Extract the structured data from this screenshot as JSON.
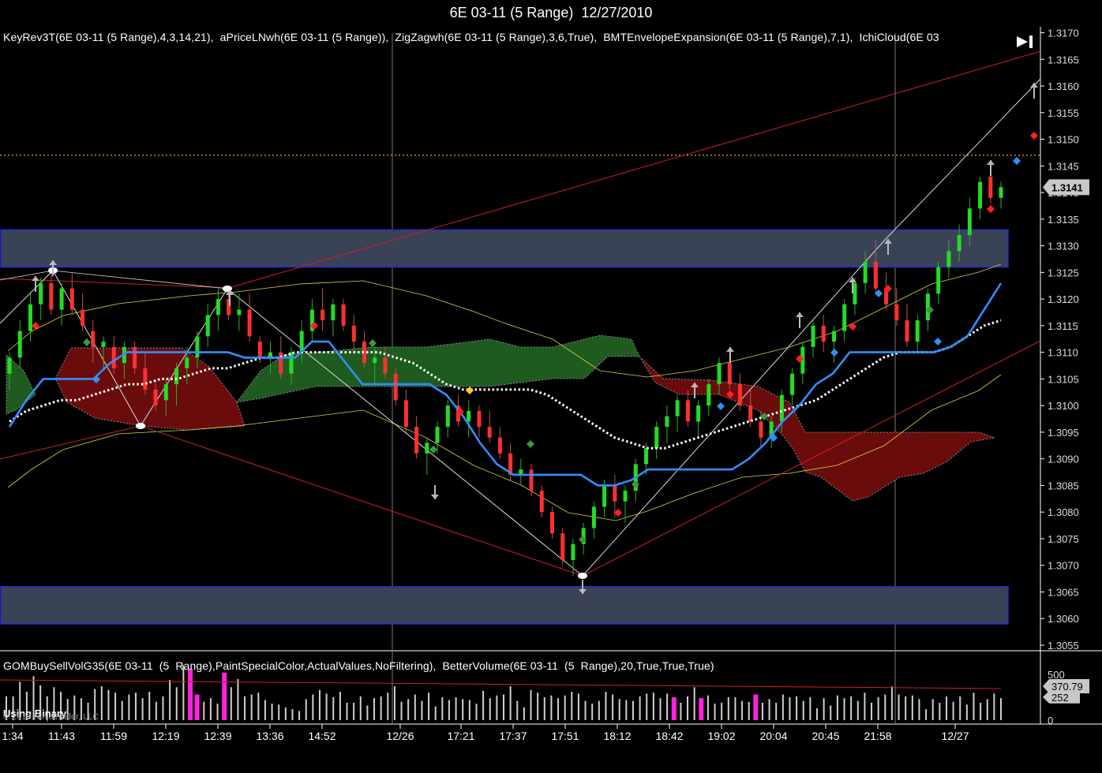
{
  "window": {
    "title": "6E 03-11 (5 Range)  12/27/2010"
  },
  "indicators_top": "KeyRev3T(6E 03-11 (5 Range),4,3,14,21),  aPriceLNwh(6E 03-11 (5 Range)),  ZigZagwh(6E 03-11 (5 Range),3,6,True),  BMTEnvelopeExpansion(6E 03-11 (5 Range),7,1),  IchiCloud(6E 03",
  "indicators_bottom": "GOMBuySellVolG35(6E 03-11  (5  Range),PaintSpecialColor,ActualValues,NoFiltering),  BetterVolume(6E 03-11  (5  Range),20,True,True,True)",
  "copyright": "© 2010 NinjaTrader, LLC",
  "using_binary": "Using Binary",
  "icons": {
    "play": "skip-forward-icon"
  },
  "colors": {
    "bull": "#22dd22",
    "bear": "#ff3030",
    "cloud_bull": "#1f5a1f",
    "cloud_bear": "#6b0c0c",
    "zone": "#3a4356",
    "kijun": "#2f8fff",
    "tenkan": "#ffffff",
    "volume_hi": "#ff22dd"
  },
  "chart_data": {
    "type": "candlestick",
    "price_axis": {
      "ylim": [
        1.3052,
        1.3172
      ],
      "ticks": [
        "1.3170",
        "1.3165",
        "1.3160",
        "1.3155",
        "1.3150",
        "1.3145",
        "1.3140",
        "1.3135",
        "1.3130",
        "1.3125",
        "1.3120",
        "1.3115",
        "1.3110",
        "1.3105",
        "1.3100",
        "1.3095",
        "1.3090",
        "1.3085",
        "1.3080",
        "1.3075",
        "1.3070",
        "1.3065",
        "1.3060",
        "1.3055"
      ],
      "last_price": "1.3141",
      "horizontal_line": 1.3147
    },
    "time_axis": {
      "labels": [
        "1:34",
        "11:43",
        "11:59",
        "12:19",
        "12:39",
        "13:36",
        "14:52",
        "12/26",
        "17:21",
        "17:37",
        "17:51",
        "18:12",
        "18:42",
        "19:02",
        "20:04",
        "20:45",
        "21:58",
        "12/27"
      ]
    },
    "zones": [
      {
        "top": 1.3133,
        "bottom": 1.3126
      },
      {
        "top": 1.3066,
        "bottom": 1.3059
      }
    ],
    "candles": [
      [
        1.3106,
        1.311,
        1.3103,
        1.3109
      ],
      [
        1.3109,
        1.3116,
        1.3107,
        1.3114
      ],
      [
        1.3114,
        1.3121,
        1.3112,
        1.3119
      ],
      [
        1.3119,
        1.3124,
        1.3116,
        1.3123
      ],
      [
        1.3123,
        1.3125,
        1.3117,
        1.3118
      ],
      [
        1.3118,
        1.3123,
        1.3115,
        1.3122
      ],
      [
        1.3122,
        1.3125,
        1.3117,
        1.3118
      ],
      [
        1.3118,
        1.3121,
        1.3114,
        1.3115
      ],
      [
        1.3114,
        1.3116,
        1.3108,
        1.3111
      ],
      [
        1.3111,
        1.3113,
        1.3107,
        1.3112
      ],
      [
        1.3111,
        1.3113,
        1.3106,
        1.3107
      ],
      [
        1.3108,
        1.3112,
        1.3105,
        1.3111
      ],
      [
        1.3111,
        1.3112,
        1.3106,
        1.3107
      ],
      [
        1.3107,
        1.311,
        1.3102,
        1.3103
      ],
      [
        1.3103,
        1.3105,
        1.3099,
        1.31
      ],
      [
        1.3101,
        1.3105,
        1.3098,
        1.3104
      ],
      [
        1.3104,
        1.3108,
        1.31,
        1.3107
      ],
      [
        1.3107,
        1.3111,
        1.3104,
        1.3109
      ],
      [
        1.3109,
        1.3114,
        1.3107,
        1.3113
      ],
      [
        1.3113,
        1.3119,
        1.3111,
        1.3117
      ],
      [
        1.3117,
        1.3122,
        1.3114,
        1.312
      ],
      [
        1.312,
        1.3122,
        1.3116,
        1.3117
      ],
      [
        1.3117,
        1.3121,
        1.3114,
        1.3118
      ],
      [
        1.3118,
        1.3121,
        1.3112,
        1.3113
      ],
      [
        1.3112,
        1.3113,
        1.3108,
        1.3109
      ],
      [
        1.3109,
        1.3112,
        1.3106,
        1.311
      ],
      [
        1.311,
        1.3113,
        1.3105,
        1.3106
      ],
      [
        1.3106,
        1.3111,
        1.3104,
        1.311
      ],
      [
        1.311,
        1.3116,
        1.3108,
        1.3114
      ],
      [
        1.3114,
        1.312,
        1.3112,
        1.3118
      ],
      [
        1.3118,
        1.3122,
        1.3114,
        1.3116
      ],
      [
        1.3116,
        1.312,
        1.3113,
        1.3119
      ],
      [
        1.3119,
        1.312,
        1.3114,
        1.3115
      ],
      [
        1.3115,
        1.3117,
        1.311,
        1.3112
      ],
      [
        1.3112,
        1.3114,
        1.3107,
        1.3108
      ],
      [
        1.3108,
        1.3111,
        1.3104,
        1.3109
      ],
      [
        1.3109,
        1.3111,
        1.3105,
        1.3106
      ],
      [
        1.3106,
        1.3107,
        1.31,
        1.3101
      ],
      [
        1.3101,
        1.3103,
        1.3095,
        1.3096
      ],
      [
        1.3096,
        1.3098,
        1.309,
        1.3091
      ],
      [
        1.3091,
        1.3094,
        1.3087,
        1.3093
      ],
      [
        1.3093,
        1.3097,
        1.3091,
        1.3096
      ],
      [
        1.3096,
        1.3101,
        1.3094,
        1.31
      ],
      [
        1.31,
        1.3102,
        1.3096,
        1.3097
      ],
      [
        1.3097,
        1.3101,
        1.3094,
        1.3099
      ],
      [
        1.3099,
        1.31,
        1.3094,
        1.3096
      ],
      [
        1.3096,
        1.3099,
        1.3093,
        1.3094
      ],
      [
        1.3094,
        1.3096,
        1.309,
        1.3091
      ],
      [
        1.3091,
        1.3093,
        1.3086,
        1.3087
      ],
      [
        1.3087,
        1.309,
        1.3085,
        1.3088
      ],
      [
        1.3088,
        1.3089,
        1.3083,
        1.3084
      ],
      [
        1.3084,
        1.3085,
        1.3079,
        1.308
      ],
      [
        1.308,
        1.3081,
        1.3075,
        1.3076
      ],
      [
        1.3076,
        1.3077,
        1.307,
        1.3071
      ],
      [
        1.3071,
        1.3075,
        1.3068,
        1.3074
      ],
      [
        1.3074,
        1.3078,
        1.3072,
        1.3077
      ],
      [
        1.3077,
        1.3082,
        1.3075,
        1.3081
      ],
      [
        1.3081,
        1.3086,
        1.3079,
        1.3085
      ],
      [
        1.3085,
        1.3087,
        1.3079,
        1.3082
      ],
      [
        1.3082,
        1.3085,
        1.3078,
        1.3084
      ],
      [
        1.3084,
        1.309,
        1.3082,
        1.3089
      ],
      [
        1.3089,
        1.3093,
        1.3087,
        1.3092
      ],
      [
        1.3092,
        1.3097,
        1.309,
        1.3096
      ],
      [
        1.3096,
        1.31,
        1.3093,
        1.3098
      ],
      [
        1.3098,
        1.3102,
        1.3095,
        1.3101
      ],
      [
        1.3101,
        1.3103,
        1.3096,
        1.3097
      ],
      [
        1.3097,
        1.3101,
        1.3094,
        1.31
      ],
      [
        1.31,
        1.3105,
        1.3098,
        1.3104
      ],
      [
        1.3104,
        1.3109,
        1.3102,
        1.3108
      ],
      [
        1.3108,
        1.3111,
        1.3103,
        1.3104
      ],
      [
        1.3104,
        1.3106,
        1.3099,
        1.31
      ],
      [
        1.31,
        1.3103,
        1.3096,
        1.3097
      ],
      [
        1.3097,
        1.3099,
        1.3092,
        1.3094
      ],
      [
        1.3094,
        1.3098,
        1.3092,
        1.3097
      ],
      [
        1.3097,
        1.3103,
        1.3095,
        1.3102
      ],
      [
        1.3102,
        1.3107,
        1.31,
        1.3106
      ],
      [
        1.3106,
        1.3112,
        1.3104,
        1.3111
      ],
      [
        1.3111,
        1.3116,
        1.3109,
        1.3115
      ],
      [
        1.3115,
        1.3117,
        1.311,
        1.3112
      ],
      [
        1.3112,
        1.3115,
        1.3108,
        1.3114
      ],
      [
        1.3114,
        1.312,
        1.3112,
        1.3119
      ],
      [
        1.3119,
        1.3124,
        1.3117,
        1.3123
      ],
      [
        1.3123,
        1.3129,
        1.3121,
        1.3127
      ],
      [
        1.3127,
        1.3131,
        1.3121,
        1.3122
      ],
      [
        1.3122,
        1.3125,
        1.3118,
        1.3119
      ],
      [
        1.3119,
        1.3122,
        1.3115,
        1.3116
      ],
      [
        1.3116,
        1.3119,
        1.3111,
        1.3112
      ],
      [
        1.3112,
        1.3117,
        1.311,
        1.3116
      ],
      [
        1.3116,
        1.3122,
        1.3114,
        1.3121
      ],
      [
        1.3121,
        1.3127,
        1.3119,
        1.3126
      ],
      [
        1.3126,
        1.3131,
        1.3124,
        1.3129
      ],
      [
        1.3129,
        1.3134,
        1.3127,
        1.3132
      ],
      [
        1.3132,
        1.3139,
        1.313,
        1.3137
      ],
      [
        1.3137,
        1.3143,
        1.3135,
        1.3142
      ],
      [
        1.3143,
        1.3146,
        1.3138,
        1.3139
      ],
      [
        1.3139,
        1.3142,
        1.3137,
        1.3141
      ]
    ],
    "tenkan": [
      1.3097,
      1.3099,
      1.31,
      1.3101,
      1.3101,
      1.3102,
      1.3103,
      1.3104,
      1.3104,
      1.3105,
      1.3105,
      1.3106,
      1.3107,
      1.3107,
      1.3108,
      1.3109,
      1.3109,
      1.311,
      1.311,
      1.311,
      1.311,
      1.311,
      1.311,
      1.3109,
      1.3108,
      1.3106,
      1.3104,
      1.3103,
      1.3103,
      1.3103,
      1.3103,
      1.3103,
      1.3102,
      1.31,
      1.3098,
      1.3096,
      1.3094,
      1.3093,
      1.3092,
      1.3092,
      1.3093,
      1.3094,
      1.3095,
      1.3096,
      1.3097,
      1.3098,
      1.3099,
      1.31,
      1.3101,
      1.3103,
      1.3105,
      1.3107,
      1.3109,
      1.311,
      1.311,
      1.311,
      1.3111,
      1.3113,
      1.3115,
      1.3116
    ],
    "kijun": [
      1.3096,
      1.3101,
      1.3105,
      1.3105,
      1.3105,
      1.3105,
      1.3108,
      1.311,
      1.311,
      1.311,
      1.311,
      1.311,
      1.311,
      1.311,
      1.3109,
      1.3109,
      1.3109,
      1.3109,
      1.3112,
      1.3112,
      1.3108,
      1.3104,
      1.3104,
      1.3104,
      1.3104,
      1.3104,
      1.3102,
      1.3098,
      1.3093,
      1.3089,
      1.3087,
      1.3087,
      1.3087,
      1.3087,
      1.3087,
      1.3085,
      1.3085,
      1.3086,
      1.3088,
      1.3088,
      1.3088,
      1.3088,
      1.3088,
      1.3088,
      1.309,
      1.3093,
      1.3097,
      1.31,
      1.3104,
      1.3106,
      1.311,
      1.311,
      1.311,
      1.311,
      1.311,
      1.311,
      1.3111,
      1.3113,
      1.3118,
      1.3123
    ],
    "volume_axis": {
      "ticks": [
        "500",
        "0"
      ],
      "value1": "370.79",
      "value2": "252"
    },
    "volume": [
      260,
      260,
      420,
      310,
      480,
      380,
      260,
      360,
      310,
      230,
      270,
      240,
      190,
      340,
      370,
      330,
      300,
      210,
      280,
      300,
      240,
      310,
      200,
      260,
      440,
      360,
      600,
      560,
      280,
      200,
      240,
      180,
      520,
      360,
      450,
      260,
      280,
      300,
      220,
      180,
      170,
      140,
      120,
      100,
      230,
      280,
      330,
      290,
      250,
      310,
      190,
      190,
      260,
      160,
      240,
      260,
      300,
      370,
      200,
      230,
      280,
      210,
      300,
      150,
      250,
      220,
      250,
      230,
      220,
      180,
      320,
      240,
      270,
      280,
      370,
      210,
      140,
      330,
      300,
      250,
      270,
      240,
      270,
      310,
      290,
      210,
      180,
      210,
      310,
      280,
      230,
      220,
      210,
      260,
      290,
      300,
      240,
      290,
      250,
      190,
      260,
      360,
      240,
      270,
      180,
      190,
      250,
      250,
      210,
      200,
      280,
      190,
      230,
      190,
      280,
      250,
      260,
      210,
      250,
      130,
      240,
      160,
      270,
      240,
      260,
      210,
      300,
      190,
      250,
      280,
      370,
      280,
      260,
      270,
      230,
      120,
      230,
      190,
      260,
      200,
      260,
      170,
      300,
      190,
      230,
      290,
      240
    ],
    "volume_highlight_indices": [
      27,
      28,
      32,
      98,
      102,
      110,
      150,
      165,
      169,
      174,
      182,
      185
    ]
  }
}
